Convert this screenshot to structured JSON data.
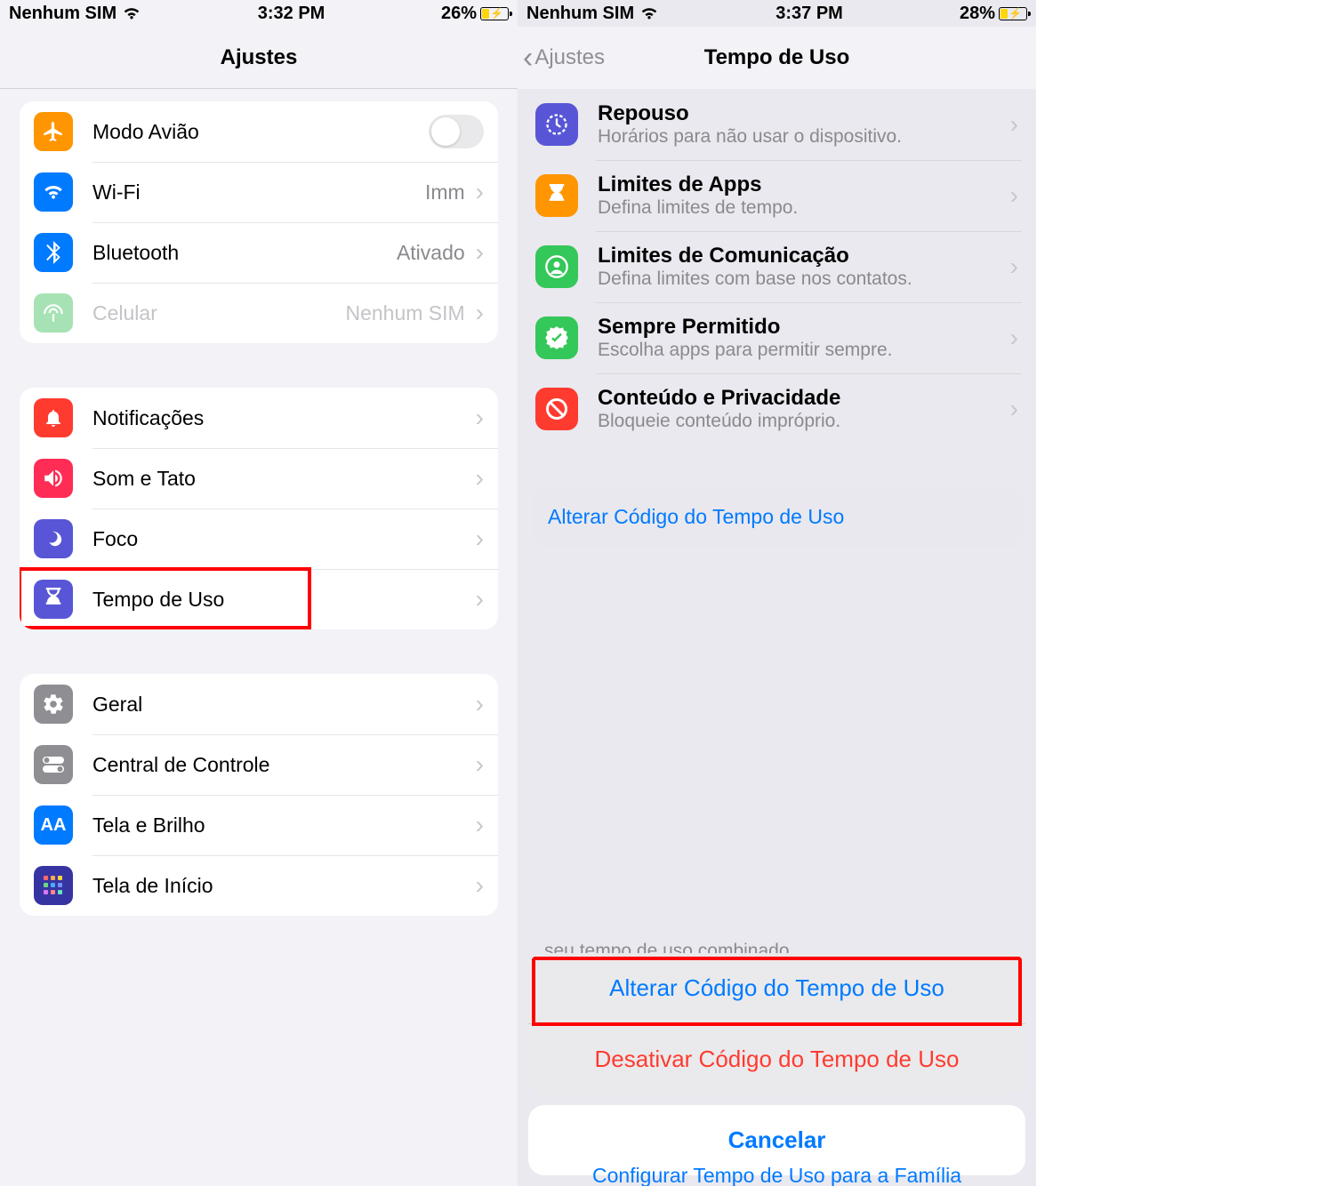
{
  "left": {
    "status": {
      "carrier": "Nenhum SIM",
      "time": "3:32 PM",
      "battery_pct": "26%",
      "battery_fill": 26
    },
    "nav_title": "Ajustes",
    "rows": {
      "airplane": "Modo Avião",
      "wifi": "Wi-Fi",
      "wifi_detail": "Imm",
      "bluetooth": "Bluetooth",
      "bluetooth_detail": "Ativado",
      "cellular": "Celular",
      "cellular_detail": "Nenhum SIM",
      "notifications": "Notificações",
      "sounds": "Som e Tato",
      "focus": "Foco",
      "screen_time": "Tempo de Uso",
      "general": "Geral",
      "control_center": "Central de Controle",
      "display": "Tela e Brilho",
      "home": "Tela de Início"
    }
  },
  "right": {
    "status": {
      "carrier": "Nenhum SIM",
      "time": "3:37 PM",
      "battery_pct": "28%",
      "battery_fill": 28
    },
    "nav_back": "Ajustes",
    "nav_title": "Tempo de Uso",
    "items": [
      {
        "title": "Repouso",
        "sub": "Horários para não usar o dispositivo."
      },
      {
        "title": "Limites de Apps",
        "sub": "Defina limites de tempo."
      },
      {
        "title": "Limites de Comunicação",
        "sub": "Defina limites com base nos contatos."
      },
      {
        "title": "Sempre Permitido",
        "sub": "Escolha apps para permitir sempre."
      },
      {
        "title": "Conteúdo e Privacidade",
        "sub": "Bloqueie conteúdo impróprio."
      }
    ],
    "link": "Alterar Código do Tempo de Uso",
    "sheet": {
      "change": "Alterar Código do Tempo de Uso",
      "disable": "Desativar Código do Tempo de Uso",
      "cancel": "Cancelar"
    },
    "partial_top": "seu tempo de uso combinado.",
    "partial_bottom": "Configurar Tempo de Uso para a Família"
  }
}
